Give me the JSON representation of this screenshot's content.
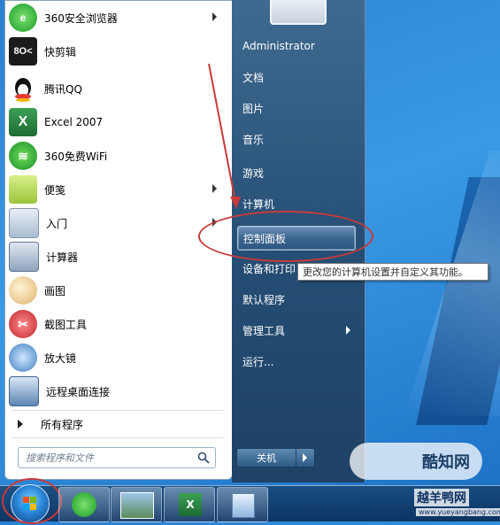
{
  "programs": [
    {
      "label": "360安全浏览器",
      "icon": "360-browser-icon",
      "has_submenu": true
    },
    {
      "label": "快剪辑",
      "icon": "kuaijianji-icon",
      "has_submenu": false
    },
    {
      "label": "腾讯QQ",
      "icon": "qq-icon",
      "has_submenu": false
    },
    {
      "label": "Excel 2007",
      "icon": "excel-icon",
      "has_submenu": false
    },
    {
      "label": "360免费WiFi",
      "icon": "360-wifi-icon",
      "has_submenu": false
    },
    {
      "label": "便笺",
      "icon": "sticky-notes-icon",
      "has_submenu": true
    },
    {
      "label": "入门",
      "icon": "getting-started-icon",
      "has_submenu": true
    },
    {
      "label": "计算器",
      "icon": "calculator-icon",
      "has_submenu": false
    },
    {
      "label": "画图",
      "icon": "paint-icon",
      "has_submenu": false
    },
    {
      "label": "截图工具",
      "icon": "snipping-tool-icon",
      "has_submenu": false
    },
    {
      "label": "放大镜",
      "icon": "magnifier-icon",
      "has_submenu": false
    },
    {
      "label": "远程桌面连接",
      "icon": "remote-desktop-icon",
      "has_submenu": false
    }
  ],
  "all_programs_label": "所有程序",
  "search": {
    "placeholder": "搜索程序和文件"
  },
  "right_items": [
    {
      "label": "Administrator"
    },
    {
      "label": "文档"
    },
    {
      "label": "图片"
    },
    {
      "label": "音乐"
    },
    {
      "label": "游戏"
    },
    {
      "label": "计算机"
    },
    {
      "label": "控制面板"
    },
    {
      "label": "设备和打印"
    },
    {
      "label": "默认程序"
    },
    {
      "label": "管理工具"
    },
    {
      "label": "运行..."
    }
  ],
  "tooltip": "更改您的计算机设置并自定义其功能。",
  "shutdown_label": "关机",
  "watermark": {
    "brand": "酷知网",
    "site": "越羊鸭网",
    "url": "www.yueyangbang.com"
  },
  "colors": {
    "annotation": "#c83a3a",
    "right_pane": "#254d73"
  }
}
